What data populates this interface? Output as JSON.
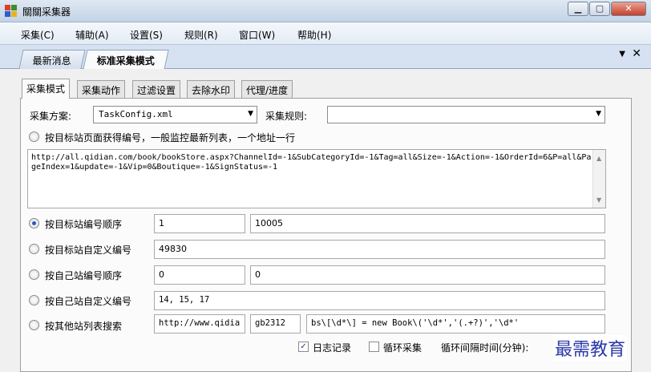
{
  "window": {
    "title": "關關采集器"
  },
  "menu": [
    "采集(C)",
    "辅助(A)",
    "设置(S)",
    "规则(R)",
    "窗口(W)",
    "帮助(H)"
  ],
  "doc_tabs": [
    "最新消息",
    "标准采集模式"
  ],
  "sub_tabs": [
    "采集模式",
    "采集动作",
    "过滤设置",
    "去除水印",
    "代理/进度"
  ],
  "form": {
    "scheme_label": "采集方案:",
    "scheme_value": "TaskConfig.xml",
    "rule_label": "采集规则:",
    "rule_value": "",
    "opt_page_label": "按目标站页面获得编号，一般监控最新列表，一个地址一行",
    "url_text": "http://all.qidian.com/book/bookStore.aspx?ChannelId=-1&SubCategoryId=-1&Tag=all&Size=-1&Action=-1&OrderId=6&P=all&PageIndex=1&update=-1&Vip=0&Boutique=-1&SignStatus=-1",
    "opt_target_seq_label": "按目标站编号顺序",
    "target_seq_from": "1",
    "target_seq_to": "10005",
    "opt_target_custom_label": "按目标站自定义编号",
    "target_custom_value": "49830",
    "opt_own_seq_label": "按自己站编号顺序",
    "own_seq_from": "0",
    "own_seq_to": "0",
    "opt_own_custom_label": "按自己站自定义编号",
    "own_custom_value": "14, 15, 17",
    "opt_other_search_label": "按其他站列表搜索",
    "search_url": "http://www.qidia",
    "search_encoding": "gb2312",
    "search_regex": "bs\\[\\d*\\] = new Book\\('\\d*','(.+?)','\\d*'",
    "log_label": "日志记录",
    "loop_label": "循环采集",
    "interval_label": "循环间隔时间(分钟):"
  },
  "watermark": "最需教育"
}
